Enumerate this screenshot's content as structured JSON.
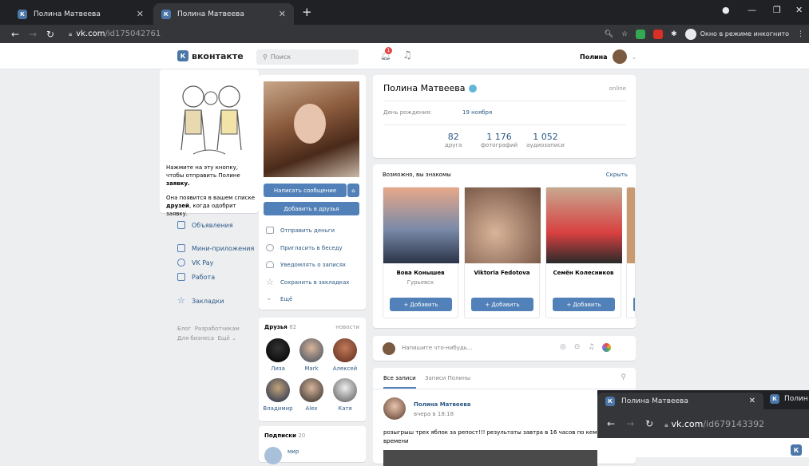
{
  "browser": {
    "tabs": [
      {
        "title": "Полина Матвеева",
        "active": false
      },
      {
        "title": "Полина Матвеева",
        "active": true
      }
    ],
    "url_host": "vk.com",
    "url_path": "/id175042761",
    "incognito_label": "Окно в режиме инкогнито"
  },
  "header": {
    "logo": "вконтакте",
    "search_placeholder": "Поиск",
    "notif_count": "1",
    "user_name": "Полина"
  },
  "left_menu": {
    "request_text_1": "Нажмите на эту кнопку, чтобы отправить Полине ",
    "request_bold_1": "заявку.",
    "request_text_2": "Она появится в вашем списке ",
    "request_bold_2": "друзей",
    "request_text_3": ", когда одобрит заявку.",
    "items": [
      "Объявления",
      "Мини-приложения",
      "VK Pay",
      "Работа",
      "Закладки"
    ],
    "footer_links": [
      "Блог",
      "Разработчикам",
      "Для бизнеса",
      "Ещё"
    ]
  },
  "profile_actions": {
    "write_message": "Написать сообщение",
    "add_friend": "Добавить в друзья",
    "actions": [
      "Отправить деньги",
      "Пригласить в беседу",
      "Уведомлять о записях",
      "Сохранить в закладках",
      "Ещё"
    ]
  },
  "friends": {
    "title": "Друзья",
    "count": "82",
    "updates": "новости",
    "list": [
      "Лиза",
      "Mark",
      "Алексей",
      "Владимир",
      "Alex",
      "Катя"
    ]
  },
  "subscriptions": {
    "title": "Подписки",
    "count": "20",
    "first": "мир"
  },
  "profile": {
    "name": "Полина Матвеева",
    "status": "online",
    "birthday_label": "День рождения:",
    "birthday_value": "19 ноября",
    "counters": [
      {
        "value": "82",
        "label": "друга"
      },
      {
        "value": "1 176",
        "label": "фотографий"
      },
      {
        "value": "1 052",
        "label": "аудиозаписи"
      }
    ]
  },
  "suggestions": {
    "title": "Возможно, вы знакомы",
    "hide": "Скрыть",
    "people": [
      {
        "name": "Вова Конышев",
        "city": "Гурьевск"
      },
      {
        "name": "Viktoria Fedotova",
        "city": ""
      },
      {
        "name": "Семён Колесников",
        "city": ""
      }
    ],
    "add_label": "+ Добавить"
  },
  "composer": {
    "placeholder": "Напишите что-нибудь..."
  },
  "wall": {
    "tabs": [
      "Все записи",
      "Записи Полины"
    ],
    "post_author": "Полина Матвеева",
    "post_time": "вчера в 18:18",
    "post_text_1": "розыгрыш трех яблок за репост!!! результаты завтра в 16 часов по кемер",
    "post_text_2": "времени"
  },
  "overlay_window": {
    "tab_title": "Полина Матвеева",
    "tab2_title": "Полин",
    "url_host": "vk.com",
    "url_path": "/id679143392"
  }
}
